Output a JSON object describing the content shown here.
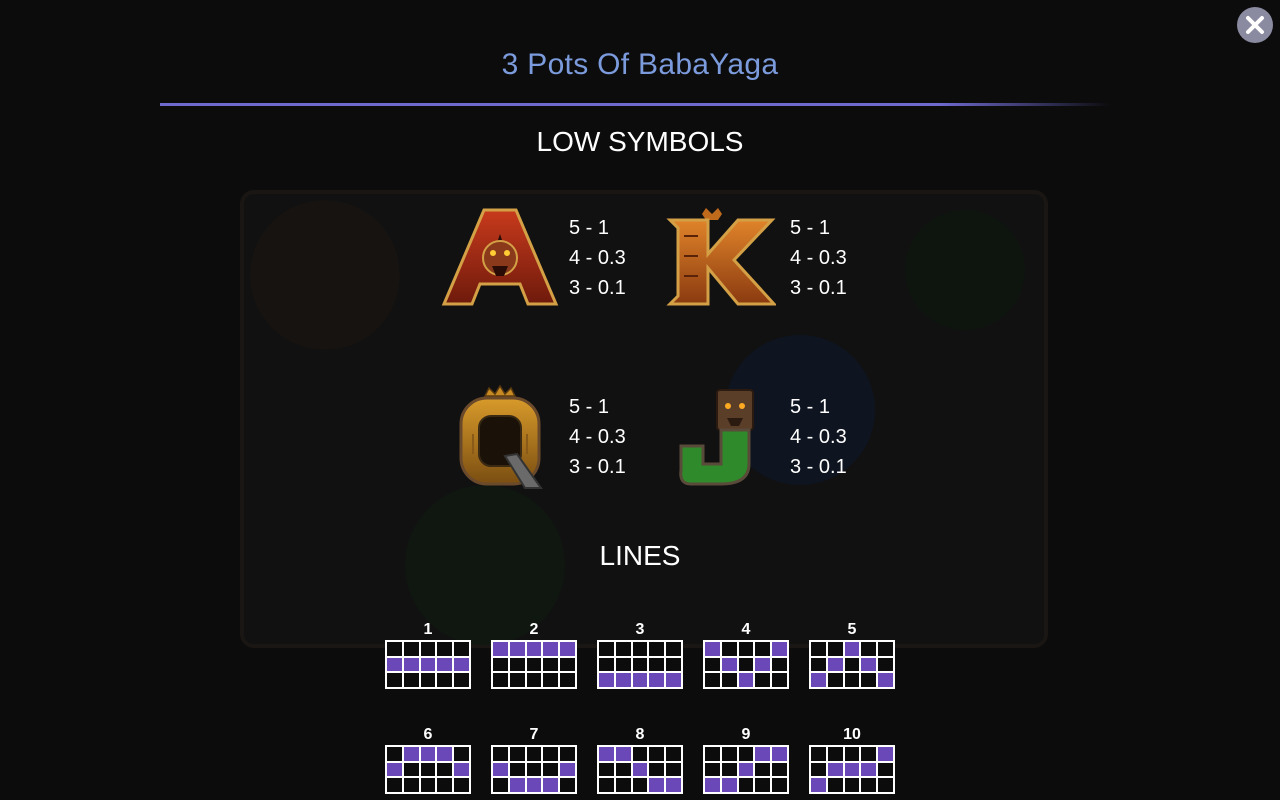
{
  "title": "3 Pots Of BabaYaga",
  "low_symbols": {
    "heading": "LOW SYMBOLS",
    "symbols": [
      {
        "name": "A",
        "pays": [
          "5 - 1",
          "4 - 0.3",
          "3 - 0.1"
        ]
      },
      {
        "name": "K",
        "pays": [
          "5 - 1",
          "4 - 0.3",
          "3 - 0.1"
        ]
      },
      {
        "name": "Q",
        "pays": [
          "5 - 1",
          "4 - 0.3",
          "3 - 0.1"
        ]
      },
      {
        "name": "J",
        "pays": [
          "5 - 1",
          "4 - 0.3",
          "3 - 0.1"
        ]
      }
    ]
  },
  "lines": {
    "heading": "LINES",
    "items": [
      {
        "num": "1",
        "rows": [
          1,
          1,
          1,
          1,
          1
        ]
      },
      {
        "num": "2",
        "rows": [
          0,
          0,
          0,
          0,
          0
        ]
      },
      {
        "num": "3",
        "rows": [
          2,
          2,
          2,
          2,
          2
        ]
      },
      {
        "num": "4",
        "rows": [
          0,
          1,
          2,
          1,
          0
        ]
      },
      {
        "num": "5",
        "rows": [
          2,
          1,
          0,
          1,
          2
        ]
      },
      {
        "num": "6",
        "rows": [
          1,
          0,
          0,
          0,
          1
        ]
      },
      {
        "num": "7",
        "rows": [
          1,
          2,
          2,
          2,
          1
        ]
      },
      {
        "num": "8",
        "rows": [
          0,
          0,
          1,
          2,
          2
        ]
      },
      {
        "num": "9",
        "rows": [
          2,
          2,
          1,
          0,
          0
        ]
      },
      {
        "num": "10",
        "rows": [
          2,
          1,
          1,
          1,
          0
        ]
      }
    ]
  },
  "colors": {
    "title": "#7b9bdc",
    "line_active": "#6a48b8",
    "rule": "#6f6ad0"
  },
  "icons": {
    "close": "close-x-icon"
  }
}
